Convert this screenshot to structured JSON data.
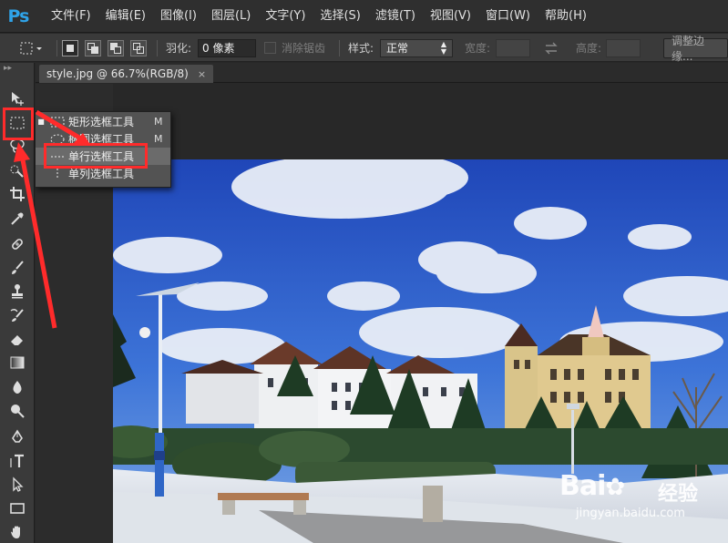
{
  "app": {
    "logo": "Ps"
  },
  "menu": [
    "文件(F)",
    "编辑(E)",
    "图像(I)",
    "图层(L)",
    "文字(Y)",
    "选择(S)",
    "滤镜(T)",
    "视图(V)",
    "窗口(W)",
    "帮助(H)"
  ],
  "options": {
    "feather_label": "羽化:",
    "feather_value": "0 像素",
    "antialias_label": "消除锯齿",
    "style_label": "样式:",
    "style_value": "正常",
    "width_label": "宽度:",
    "height_label": "高度:",
    "refine_edge_label": "调整边缘..."
  },
  "toolbox": {
    "grip": "▸▸"
  },
  "document": {
    "tab_title": "style.jpg @ 66.7%(RGB/8)",
    "tab_close": "×"
  },
  "flyout": {
    "items": [
      {
        "label": "矩形选框工具",
        "shortcut": "M",
        "icon": "rect-marquee-icon",
        "selected": true
      },
      {
        "label": "椭圆选框工具",
        "shortcut": "M",
        "icon": "ellipse-marquee-icon",
        "selected": false
      },
      {
        "label": "单行选框工具",
        "shortcut": "",
        "icon": "single-row-marquee-icon",
        "selected": false,
        "highlighted": true
      },
      {
        "label": "单列选框工具",
        "shortcut": "",
        "icon": "single-column-marquee-icon",
        "selected": false
      }
    ]
  },
  "watermark": {
    "logo": "Bai",
    "logo_suffix": "经验",
    "url": "jingyan.baidu.com"
  },
  "colors": {
    "accent": "#2fa3e8",
    "annotation": "#ff2b2b"
  }
}
